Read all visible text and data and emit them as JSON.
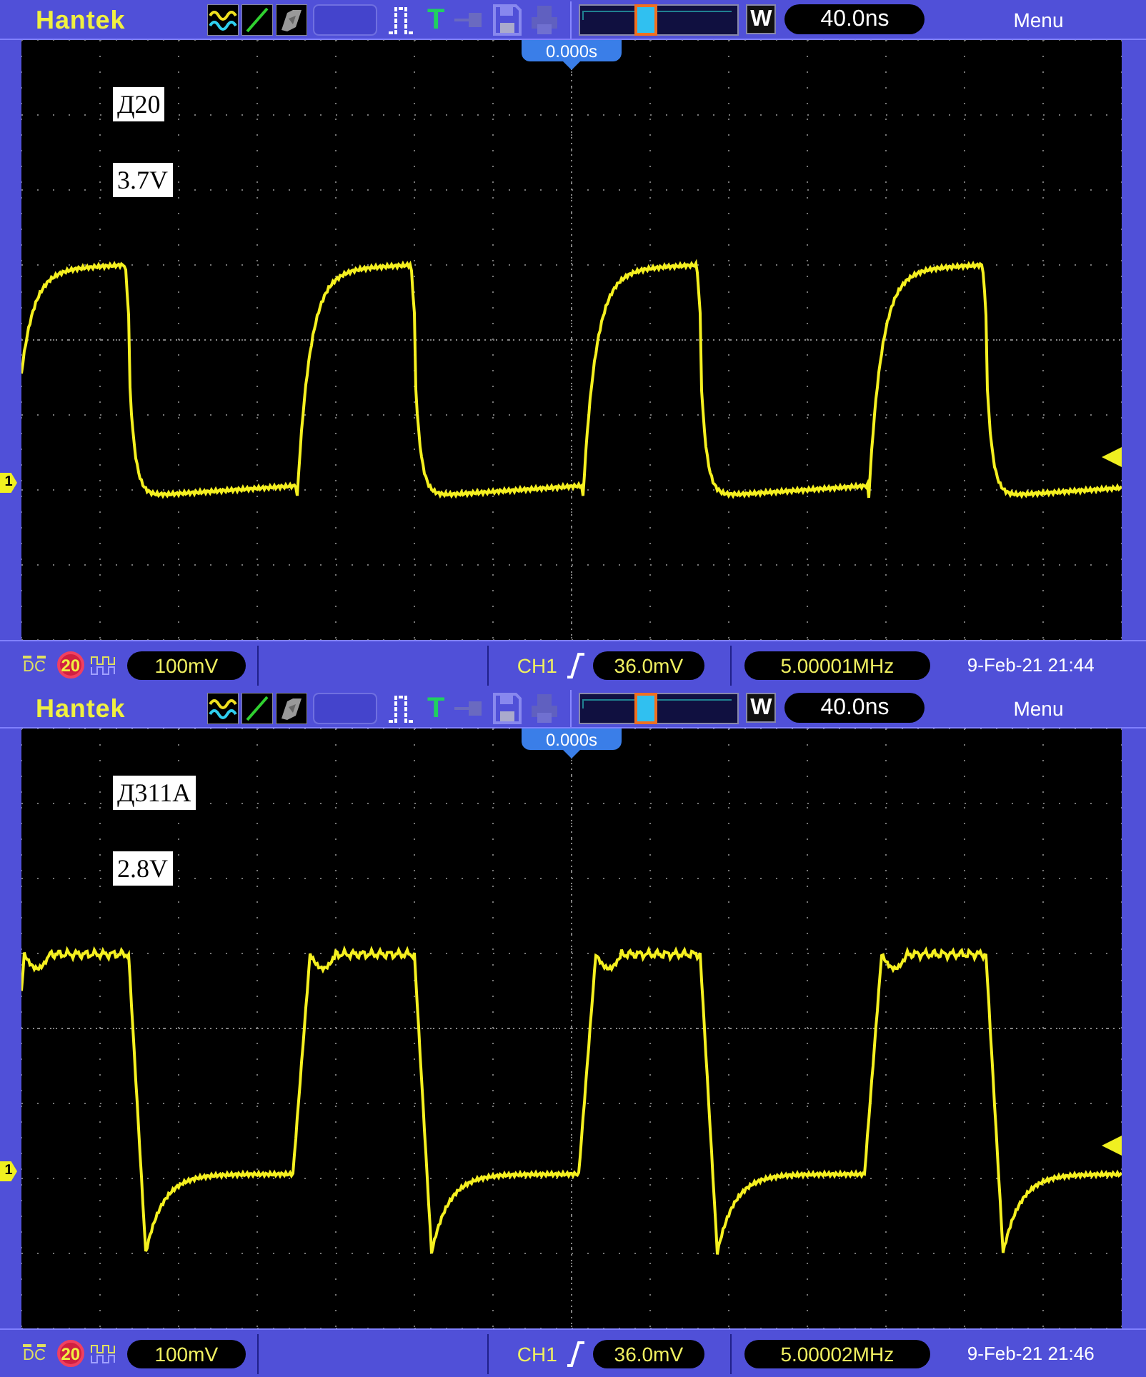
{
  "panels": [
    {
      "top_bar": {
        "brand": "Hantek",
        "trigger_mode": "T",
        "zoom_key": "W",
        "timebase": "40.0ns",
        "menu": "Menu"
      },
      "trigger_position": "0.000s",
      "labels": [
        "Д20",
        "3.7V"
      ],
      "channel_marker": "1",
      "waveform": {
        "kind": "rounded"
      },
      "status_bar": {
        "coupling": "DC",
        "bandwidth_limit": "20",
        "volts_div": "100mV",
        "trigger_source": "CH1",
        "trigger_level": "36.0mV",
        "frequency": "5.00001MHz",
        "datetime": "9-Feb-21 21:44"
      }
    },
    {
      "top_bar": {
        "brand": "Hantek",
        "trigger_mode": "T",
        "zoom_key": "W",
        "timebase": "40.0ns",
        "menu": "Menu"
      },
      "trigger_position": "0.000s",
      "labels": [
        "Д311А",
        "2.8V"
      ],
      "channel_marker": "1",
      "waveform": {
        "kind": "ringing"
      },
      "status_bar": {
        "coupling": "DC",
        "bandwidth_limit": "20",
        "volts_div": "100mV",
        "trigger_source": "CH1",
        "trigger_level": "36.0mV",
        "frequency": "5.00002MHz",
        "datetime": "9-Feb-21 21:46"
      }
    }
  ]
}
